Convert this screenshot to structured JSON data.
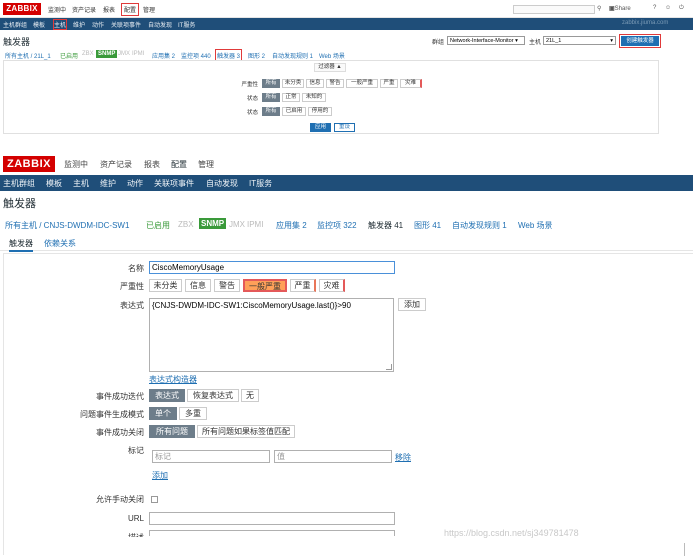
{
  "top": {
    "logo": "ZABBIX",
    "menu": [
      "监测中",
      "资产记录",
      "报表",
      "配置",
      "管理"
    ],
    "search_icon": "search-icon",
    "share": "Share",
    "help": "?",
    "user_icon": "user-icon",
    "power_icon": "power-icon",
    "submenu": [
      "主机群组",
      "模板",
      "主机",
      "维护",
      "动作",
      "关联项事件",
      "自动发现",
      "IT服务"
    ],
    "submenu_right": "zabbix.jiuma.com",
    "title": "触发器",
    "group_label": "群组",
    "group_value": "Network-Interface-Monitor",
    "host_label": "主机",
    "host_value": "21L_1",
    "create_button": "创建触发器",
    "breadcrumb": {
      "all_hosts": "所有主机 / 21L_1",
      "enabled": "已启用",
      "zbx": "ZBX",
      "snmp": "SNMP",
      "jmx": "JMX",
      "ipmi": "IPMI",
      "apps": "应用集 2",
      "items": "监控项 440",
      "triggers": "触发器 3",
      "graphs": "图形 2",
      "discovery": "自动发现规则 1",
      "web": "Web 场景"
    },
    "filter": {
      "tab": "过滤器 ▲",
      "severity_label": "严重性",
      "severity_options": [
        "所有",
        "未分类",
        "信息",
        "警告",
        "一般严重",
        "严重",
        "灾难"
      ],
      "state_label": "状态",
      "state_options": [
        "所有",
        "正常",
        "未知的"
      ],
      "status_label": "状态",
      "status_options": [
        "所有",
        "已启用",
        "停用的"
      ],
      "apply": "应用",
      "reset": "重设"
    }
  },
  "bottom": {
    "logo": "ZABBIX",
    "menu": [
      "监测中",
      "资产记录",
      "报表",
      "配置",
      "管理"
    ],
    "submenu": [
      "主机群组",
      "模板",
      "主机",
      "维护",
      "动作",
      "关联项事件",
      "自动发现",
      "IT服务"
    ],
    "title": "触发器",
    "breadcrumb": {
      "all_hosts": "所有主机 / CNJS-DWDM-IDC-SW1",
      "enabled": "已启用",
      "zbx": "ZBX",
      "snmp": "SNMP",
      "jmx": "JMX",
      "ipmi": "IPMI",
      "apps": "应用集 2",
      "items": "监控项 322",
      "triggers": "触发器 41",
      "graphs": "图形 41",
      "discovery": "自动发现规则 1",
      "web": "Web 场景"
    },
    "tabs": [
      "触发器",
      "依赖关系"
    ],
    "form": {
      "name_label": "名称",
      "name_value": "CiscoMemoryUsage",
      "severity_label": "严重性",
      "severity_options": [
        "未分类",
        "信息",
        "警告",
        "一般严重",
        "严重",
        "灾难"
      ],
      "expression_label": "表达式",
      "expression_value": "{CNJS-DWDM-IDC-SW1:CiscoMemoryUsage.last()}>90",
      "add_button": "添加",
      "expression_builder": "表达式构造器",
      "ok_event_label": "事件成功迭代",
      "ok_event_options": [
        "表达式",
        "恢复表达式",
        "无"
      ],
      "problem_mode_label": "问题事件生成模式",
      "problem_mode_options": [
        "单个",
        "多重"
      ],
      "ok_close_label": "事件成功关闭",
      "ok_close_options": [
        "所有问题",
        "所有问题如果标签值匹配"
      ],
      "tags_label": "标记",
      "tag_placeholder": "标记",
      "value_placeholder": "值",
      "remove_link": "移除",
      "add_link": "添加",
      "manual_close_label": "允许手动关闭",
      "url_label": "URL",
      "desc_label": "描述"
    },
    "watermark": "https://blog.csdn.net/sj349781478"
  }
}
